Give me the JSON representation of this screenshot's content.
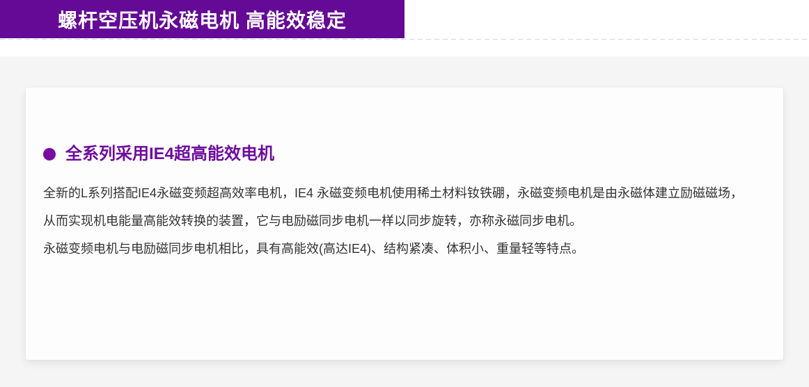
{
  "page": {
    "background_color": "#f5f5f6",
    "header": {
      "banner": {
        "title": "螺杆空压机永磁电机 高能效稳定",
        "background_color": "#650a96",
        "text_color": "#ffffff"
      },
      "divider_style": "dashed",
      "divider_color": "#d4d4d4"
    },
    "card": {
      "background_color": "#fdfdfd",
      "heading": {
        "bullet_icon": "filled-circle",
        "text": "全系列采用IE4超高能效电机",
        "color": "#6e0b9d"
      },
      "body": {
        "text_color": "#333333",
        "lines": [
          "全新的L系列搭配IE4永磁变频超高效率电机，IE4 永磁变频电机使用稀土材料钕铁硼，永磁变频电机是由永磁体建立励磁磁场，",
          "从而实现机电能量高能效转换的装置，它与电励磁同步电机一样以同步旋转，亦称永磁同步电机。",
          "永磁变频电机与电励磁同步电机相比，具有高能效(高达IE4)、结构紧凑、体积小、重量轻等特点。"
        ]
      }
    }
  }
}
